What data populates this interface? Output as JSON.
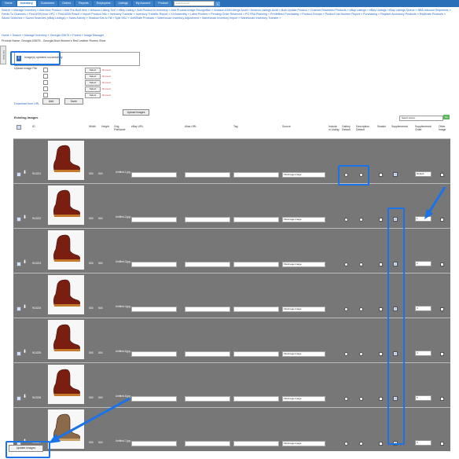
{
  "topnav": {
    "tabs": [
      "Home",
      "Inventory",
      "Customers",
      "Orders",
      "Reports",
      "Employees",
      "Listings",
      "My Account",
      "Product"
    ],
    "active_tab": "Inventory",
    "search_placeholder": "search terms",
    "go_label": "»"
  },
  "submenu": {
    "links": [
      "Search",
      "Manage Inventory",
      "Add New Product",
      "Add Pre-Built Item",
      "Amazon Listing Tool",
      "eBay Listing",
      "Add Product to Inventory",
      "Add Product Image Recognition",
      "Amazon ASIN Merge Audit",
      "Amazon Listings Audit",
      "Bulk Update Product",
      "Channel Restricted Products",
      "eBay Listings",
      "eBay Listings / eBay Listings Queue",
      "NBA Inbound Shipments",
      "Feeds To Channels",
      "Find ASIN from UPC",
      "Find ASIN Result",
      "Import Product Info",
      "Inventory Transfer",
      "Inventory Transfer Report",
      "Kit Assembly",
      "Label Printers",
      "Pending Order Reserved",
      "PO FBA Planning",
      "Predefined Purchasing",
      "Product Groups",
      "Product List Number Report",
      "Purchasing",
      "Replace Accessory Products",
      "Replicate Products",
      "Saved Searches",
      "Saved Searches (eBay Listings)",
      "Sales Activity",
      "Shadow Kits to Fill",
      "Split SKU",
      "UnfillSafe Products",
      "Warehouse Inventory Adjustment",
      "Warehouse Inventory Import",
      "Warehouse Inventory Transfer"
    ]
  },
  "breadcrumb": "Home » Search » Manage Inventory » Georgia G5675 » Parent » Image Manager",
  "product_name": "Product Name: Georgia G5675 - Georgia Boot Women's Red Leather Romeo Shoe",
  "sidebar_tab": "Tab Tools",
  "message": "Image(s) updated successfully",
  "upload": {
    "label": "Upload Image File",
    "select_label": "Select",
    "remove_label": "Remove",
    "rows": 5
  },
  "download_url_label": "Download from URL",
  "add_label": "Add",
  "done_label": "Done",
  "upload_images_label": "Upload Images",
  "existing_images_label": "Existing Images",
  "select_action": "Select Action",
  "go2_label": "Go",
  "columns": {
    "id": "ID",
    "width": "Width",
    "height": "Height",
    "orig": "Orig. FileName",
    "ebay_url": "eBay URL",
    "alias_url": "Alias URL",
    "tag": "Tag",
    "source": "Source",
    "include": "Include in Listing",
    "gallery": "Gallery Default",
    "description": "Description Default",
    "swatch": "Swatch",
    "supplemental": "Supplemental",
    "order": "Supplemental Order",
    "other": "Other Image"
  },
  "rows": [
    {
      "id": "910221",
      "w": "500",
      "h": "500",
      "file": "Untitled-1.jpg",
      "source": "FileImage-Image",
      "order": "Default"
    },
    {
      "id": "910222",
      "w": "500",
      "h": "500",
      "file": "Untitled-2.jpg",
      "source": "FileImage-Image",
      "order": "1"
    },
    {
      "id": "910223",
      "w": "500",
      "h": "500",
      "file": "Untitled-3.jpg",
      "source": "FileImage-Image",
      "order": "2"
    },
    {
      "id": "910224",
      "w": "500",
      "h": "500",
      "file": "Untitled-4.jpg",
      "source": "FileImage-Image",
      "order": "3"
    },
    {
      "id": "910225",
      "w": "500",
      "h": "500",
      "file": "Untitled-5.jpg",
      "source": "FileImage-Image",
      "order": "4"
    },
    {
      "id": "910226",
      "w": "500",
      "h": "500",
      "file": "Untitled-6.jpg",
      "source": "FileImage-Image",
      "order": "5"
    },
    {
      "id": "910227",
      "w": "500",
      "h": "500",
      "file": "Untitled-7.jpg",
      "source": "FileImage-Image",
      "order": "6"
    }
  ],
  "update_images_label": "Update Images",
  "colors": {
    "nav": "#2a70b8",
    "accent": "#1a73e8",
    "row_bg": "#777777",
    "go": "#5cb85c"
  }
}
